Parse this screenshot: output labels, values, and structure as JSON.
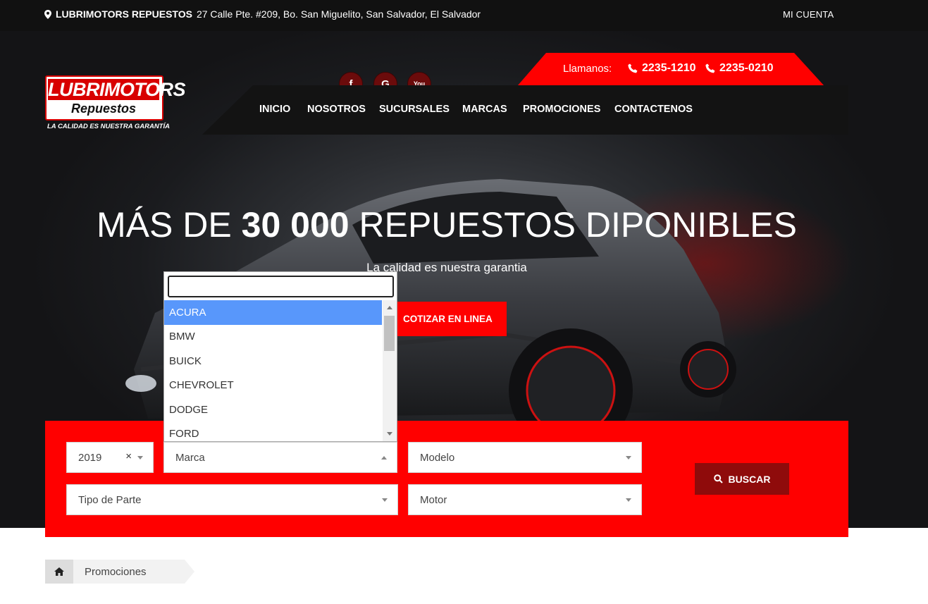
{
  "topbar": {
    "brand": "LUBRIMOTORS REPUESTOS",
    "address": "27 Calle Pte. #209, Bo. San Miguelito, San Salvador, El Salvador",
    "account_label": "MI CUENTA",
    "location_icon": "map-marker-icon"
  },
  "social": [
    {
      "glyph": "f",
      "icon": "facebook-icon"
    },
    {
      "glyph": "G",
      "icon": "google-icon"
    },
    {
      "glyph": "You",
      "icon": "youtube-icon"
    }
  ],
  "logo": {
    "line1": "LUBRIMOTORS",
    "line2": "Repuestos",
    "tagline": "LA CALIDAD ES NUESTRA GARANTÍA"
  },
  "call": {
    "label": "Llamanos:",
    "phone1": "2235-1210",
    "phone2": "2235-0210"
  },
  "nav": {
    "items": [
      "INICIO",
      "NOSOTROS",
      "SUCURSALES",
      "MARCAS",
      "PROMOCIONES",
      "CONTACTENOS"
    ]
  },
  "hero": {
    "headline_pre": "MÁS DE",
    "headline_bold": "30 000",
    "headline_post": "REPUESTOS DIPONIBLES",
    "subtitle": "La calidad es nuestra garantia",
    "quote_button": "COTIZAR EN LINEA"
  },
  "search": {
    "year": "2019",
    "clear_glyph": "×",
    "brand_placeholder": "Marca",
    "model_placeholder": "Modelo",
    "part_placeholder": "Tipo de Parte",
    "engine_placeholder": "Motor",
    "button": "BUSCAR"
  },
  "dropdown": {
    "search_value": "",
    "options": [
      "ACURA",
      "BMW",
      "BUICK",
      "CHEVROLET",
      "DODGE",
      "FORD"
    ],
    "highlighted": "ACURA"
  },
  "breadcrumb": {
    "current": "Promociones"
  },
  "colors": {
    "brand_red": "#ff0000",
    "dark_red": "#8f0b0b",
    "highlight_blue": "#5897fb"
  }
}
